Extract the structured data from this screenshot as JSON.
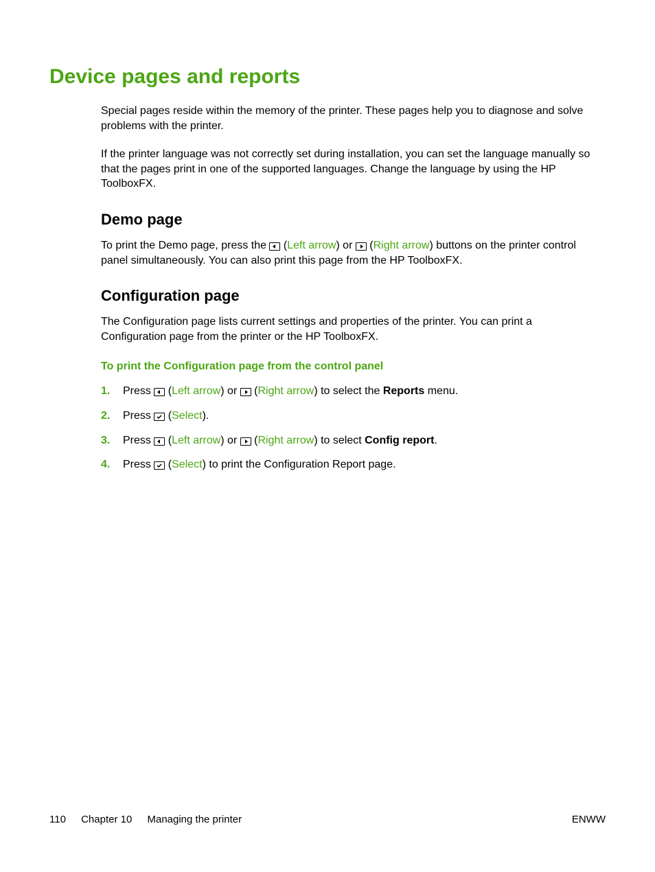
{
  "title": "Device pages and reports",
  "intro1": "Special pages reside within the memory of the printer. These pages help you to diagnose and solve problems with the printer.",
  "intro2": "If the printer language was not correctly set during installation, you can set the language manually so that the pages print in one of the supported languages. Change the language by using the HP ToolboxFX.",
  "demo": {
    "heading": "Demo page",
    "text_a": "To print the Demo page, press the ",
    "left_arrow": "Left arrow",
    "or": " or ",
    "right_arrow": "Right arrow",
    "text_b": " buttons on the printer control panel simultaneously. You can also print this page from the HP ToolboxFX."
  },
  "config": {
    "heading": "Configuration page",
    "text": "The Configuration page lists current settings and properties of the printer. You can print a Configuration page from the printer or the HP ToolboxFX.",
    "subheading": "To print the Configuration page from the control panel",
    "steps": {
      "s1": {
        "num": "1.",
        "pre": "Press ",
        "left": "Left arrow",
        "or": " or ",
        "right": "Right arrow",
        "post1": " to select the ",
        "bold": "Reports",
        "post2": " menu."
      },
      "s2": {
        "num": "2.",
        "pre": "Press ",
        "select": "Select",
        "post": "."
      },
      "s3": {
        "num": "3.",
        "pre": "Press ",
        "left": "Left arrow",
        "or": " or ",
        "right": "Right arrow",
        "post1": " to select ",
        "bold": "Config report",
        "post2": "."
      },
      "s4": {
        "num": "4.",
        "pre": "Press ",
        "select": "Select",
        "post": " to print the Configuration Report page."
      }
    }
  },
  "footer": {
    "page_num": "110",
    "chapter": "Chapter 10",
    "section": "Managing the printer",
    "right": "ENWW"
  }
}
